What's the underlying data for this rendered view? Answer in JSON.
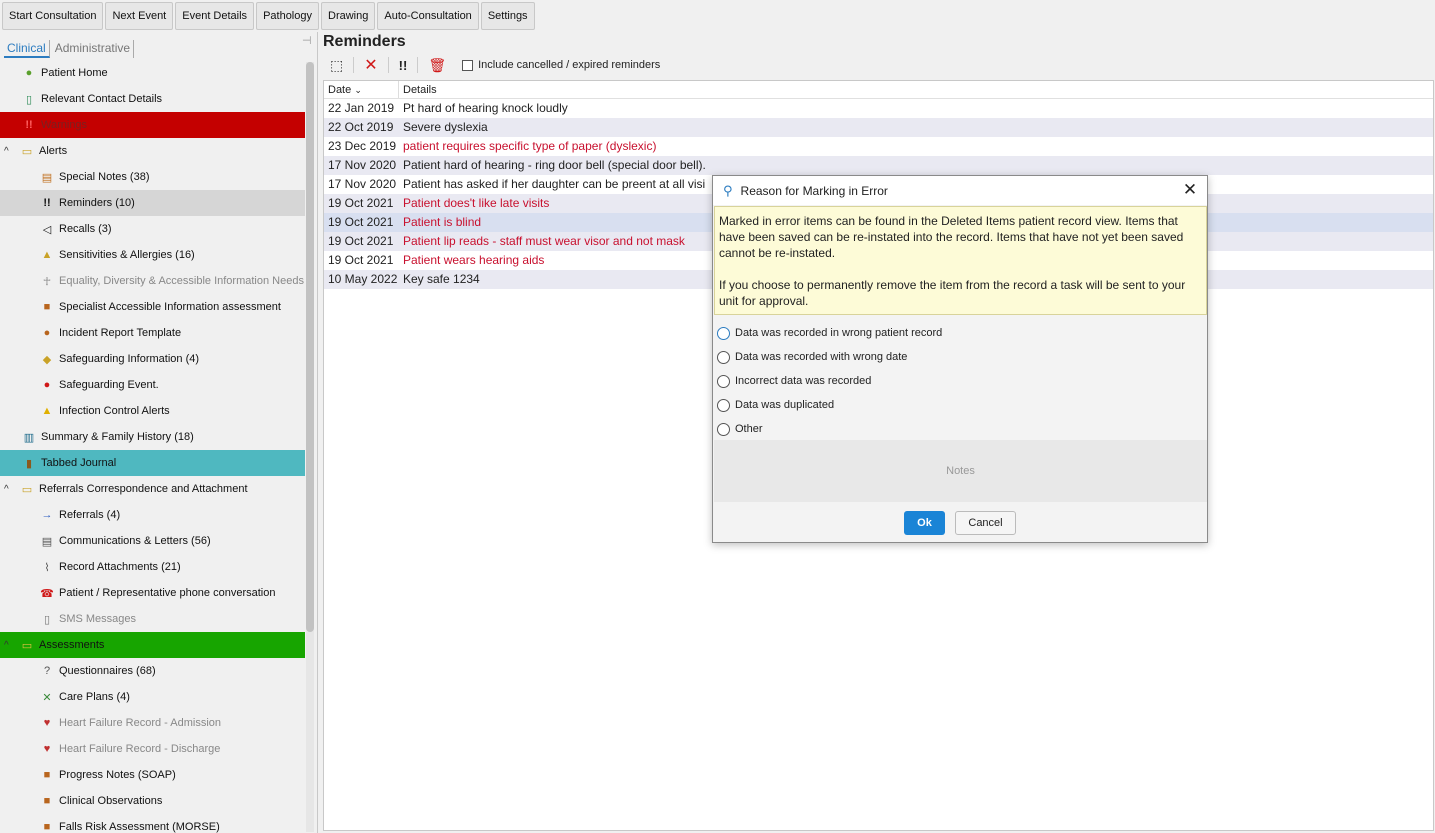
{
  "topbar": {
    "buttons": [
      "Start Consultation",
      "Next Event",
      "Event Details",
      "Pathology",
      "Drawing",
      "Auto-Consultation",
      "Settings"
    ]
  },
  "sidebar": {
    "tabs": [
      "Clinical",
      "Administrative"
    ],
    "items": [
      {
        "label": "Patient Home",
        "icon": "person-icon",
        "color": "#5aa02c"
      },
      {
        "label": "Relevant Contact Details",
        "icon": "phone-icon",
        "color": "#2e8b57"
      },
      {
        "label": "Warnings",
        "icon": "exclamation-icon",
        "color": "#c40000"
      },
      {
        "label": "Alerts",
        "icon": "folder-icon"
      },
      {
        "label": "Special Notes (38)",
        "icon": "note-icon"
      },
      {
        "label": "Reminders (10)",
        "icon": "exclamation-icon"
      },
      {
        "label": "Recalls (3)",
        "icon": "megaphone-icon"
      },
      {
        "label": "Sensitivities & Allergies (16)",
        "icon": "allergy-icon"
      },
      {
        "label": "Equality, Diversity & Accessible Information Needs",
        "icon": "person-outline-icon"
      },
      {
        "label": "Specialist Accessible Information assessment",
        "icon": "square-icon"
      },
      {
        "label": "Incident Report Template",
        "icon": "circle-icon"
      },
      {
        "label": "Safeguarding Information (4)",
        "icon": "safeguard-icon"
      },
      {
        "label": "Safeguarding Event.",
        "icon": "alert-circle-icon"
      },
      {
        "label": "Infection Control Alerts",
        "icon": "warning-icon"
      },
      {
        "label": "Summary & Family History (18)",
        "icon": "book-icon"
      },
      {
        "label": "Tabbed Journal",
        "icon": "journal-icon"
      },
      {
        "label": "Referrals Correspondence and Attachment",
        "icon": "folder-icon"
      },
      {
        "label": "Referrals (4)",
        "icon": "arrow-icon"
      },
      {
        "label": "Communications & Letters (56)",
        "icon": "document-icon"
      },
      {
        "label": "Record Attachments (21)",
        "icon": "paperclip-icon"
      },
      {
        "label": "Patient / Representative phone conversation",
        "icon": "telephone-icon"
      },
      {
        "label": "SMS Messages",
        "icon": "mobile-icon"
      },
      {
        "label": "Assessments",
        "icon": "folder-icon"
      },
      {
        "label": "Questionnaires (68)",
        "icon": "question-icon"
      },
      {
        "label": "Care Plans (4)",
        "icon": "tools-icon"
      },
      {
        "label": "Heart Failure Record - Admission",
        "icon": "heart-icon"
      },
      {
        "label": "Heart Failure Record - Discharge",
        "icon": "heart-icon"
      },
      {
        "label": "Progress Notes (SOAP)",
        "icon": "square-icon"
      },
      {
        "label": "Clinical Observations",
        "icon": "square-icon"
      },
      {
        "label": "Falls Risk Assessment (MORSE)",
        "icon": "square-icon"
      }
    ]
  },
  "reminders": {
    "title": "Reminders",
    "include_label": "Include cancelled / expired reminders",
    "columns": [
      "Date",
      "Details"
    ],
    "rows": [
      {
        "date": "22 Jan 2019",
        "details": "Pt hard of hearing knock loudly"
      },
      {
        "date": "22 Oct 2019",
        "details": "Severe dyslexia"
      },
      {
        "date": "23 Dec 2019",
        "details": "patient requires specific type of paper (dyslexic)"
      },
      {
        "date": "17 Nov 2020",
        "details": "Patient hard of hearing - ring door bell (special door bell)."
      },
      {
        "date": "17 Nov 2020",
        "details": "Patient has asked if her daughter can be preent at all visi"
      },
      {
        "date": "19 Oct 2021",
        "details": "Patient does't like late visits"
      },
      {
        "date": "19 Oct 2021",
        "details": "Patient is blind"
      },
      {
        "date": "19 Oct 2021",
        "details": "Patient lip reads - staff must wear visor and not mask"
      },
      {
        "date": "19 Oct 2021",
        "details": "Patient wears hearing aids"
      },
      {
        "date": "10 May 2022",
        "details": "Key safe 1234"
      }
    ]
  },
  "dialog": {
    "title": "Reason for Marking in Error",
    "info_p1": "Marked in error items can be found in the Deleted Items patient record view. Items that have been saved can be re-instated into the record. Items that have not yet been saved cannot be re-instated.",
    "info_p2": "If you choose to permanently remove the item from the record a task will be sent to your unit for approval.",
    "options": [
      "Data was recorded in wrong patient record",
      "Data was recorded with wrong date",
      "Incorrect data was recorded",
      "Data was duplicated",
      "Other"
    ],
    "notes_placeholder": "Notes",
    "ok_label": "Ok",
    "cancel_label": "Cancel"
  }
}
